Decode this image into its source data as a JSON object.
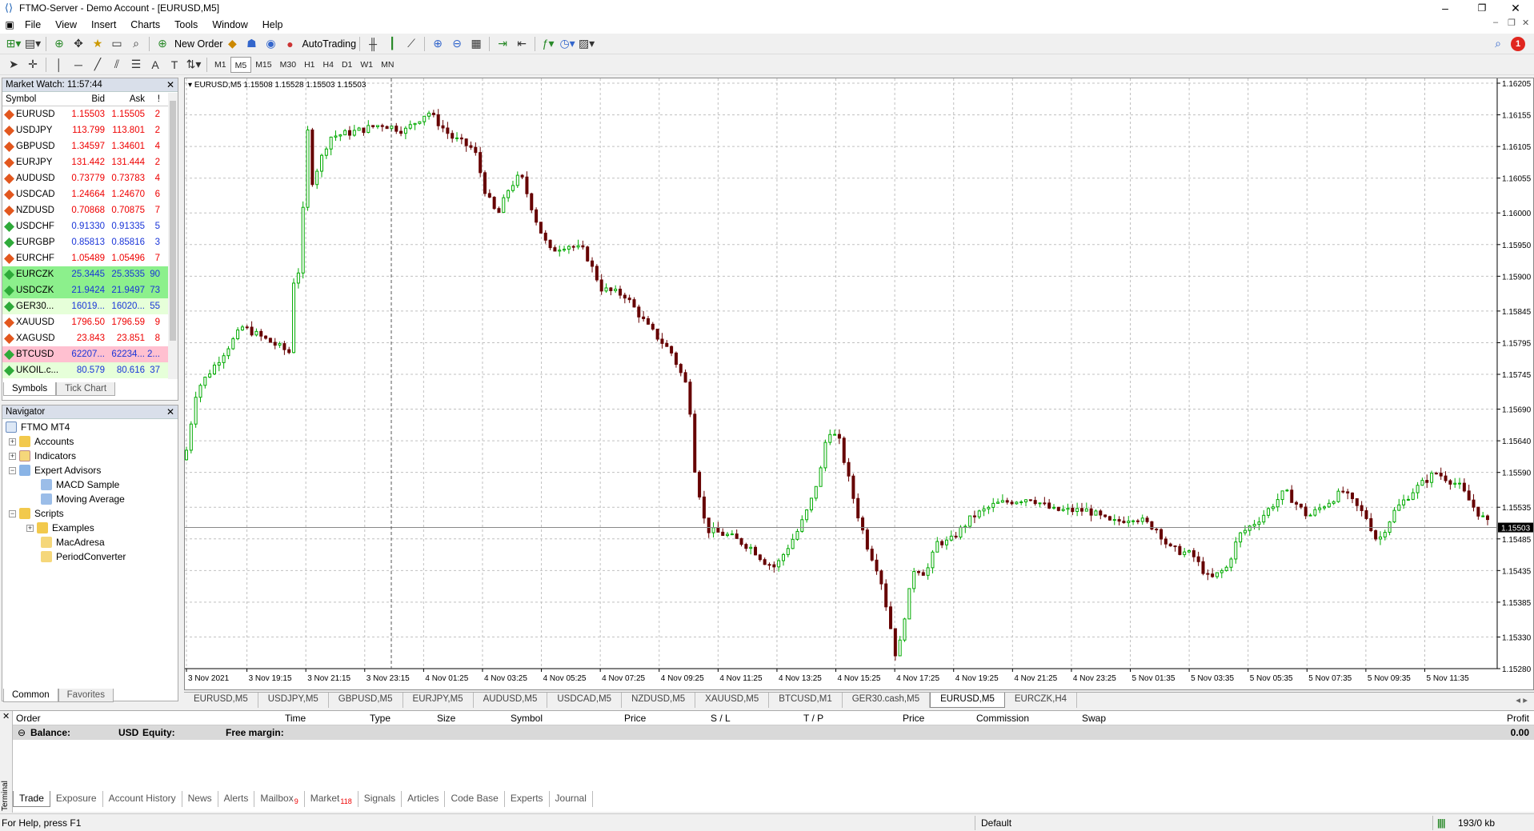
{
  "window": {
    "title": "FTMO-Server - Demo Account - [EURUSD,M5]"
  },
  "menu": [
    "File",
    "View",
    "Insert",
    "Charts",
    "Tools",
    "Window",
    "Help"
  ],
  "toolbar": {
    "new_order": "New Order",
    "autotrading": "AutoTrading",
    "alert_count": "1"
  },
  "timeframes": [
    "M1",
    "M5",
    "M15",
    "M30",
    "H1",
    "H4",
    "D1",
    "W1",
    "MN"
  ],
  "timeframe_active": "M5",
  "market_watch": {
    "title": "Market Watch: 11:57:44",
    "headers": {
      "symbol": "Symbol",
      "bid": "Bid",
      "ask": "Ask",
      "spread": "!"
    },
    "rows": [
      {
        "symbol": "EURUSD",
        "bid": "1.15503",
        "ask": "1.15505",
        "spread": "2",
        "dir": "up",
        "bg": "#ffffff",
        "icon": "#e2571e"
      },
      {
        "symbol": "USDJPY",
        "bid": "113.799",
        "ask": "113.801",
        "spread": "2",
        "dir": "up",
        "bg": "#ffffff",
        "icon": "#e2571e"
      },
      {
        "symbol": "GBPUSD",
        "bid": "1.34597",
        "ask": "1.34601",
        "spread": "4",
        "dir": "up",
        "bg": "#ffffff",
        "icon": "#e2571e"
      },
      {
        "symbol": "EURJPY",
        "bid": "131.442",
        "ask": "131.444",
        "spread": "2",
        "dir": "up",
        "bg": "#ffffff",
        "icon": "#e2571e"
      },
      {
        "symbol": "AUDUSD",
        "bid": "0.73779",
        "ask": "0.73783",
        "spread": "4",
        "dir": "up",
        "bg": "#ffffff",
        "icon": "#e2571e"
      },
      {
        "symbol": "USDCAD",
        "bid": "1.24664",
        "ask": "1.24670",
        "spread": "6",
        "dir": "up",
        "bg": "#ffffff",
        "icon": "#e2571e"
      },
      {
        "symbol": "NZDUSD",
        "bid": "0.70868",
        "ask": "0.70875",
        "spread": "7",
        "dir": "up",
        "bg": "#ffffff",
        "icon": "#e2571e"
      },
      {
        "symbol": "USDCHF",
        "bid": "0.91330",
        "ask": "0.91335",
        "spread": "5",
        "dir": "dn",
        "bg": "#ffffff",
        "icon": "#2faa3a"
      },
      {
        "symbol": "EURGBP",
        "bid": "0.85813",
        "ask": "0.85816",
        "spread": "3",
        "dir": "dn",
        "bg": "#ffffff",
        "icon": "#2faa3a"
      },
      {
        "symbol": "EURCHF",
        "bid": "1.05489",
        "ask": "1.05496",
        "spread": "7",
        "dir": "up",
        "bg": "#ffffff",
        "icon": "#e2571e"
      },
      {
        "symbol": "EURCZK",
        "bid": "25.3445",
        "ask": "25.3535",
        "spread": "90",
        "dir": "dn",
        "bg": "#8cf08c",
        "icon": "#2faa3a"
      },
      {
        "symbol": "USDCZK",
        "bid": "21.9424",
        "ask": "21.9497",
        "spread": "73",
        "dir": "dn",
        "bg": "#8cf08c",
        "icon": "#2faa3a"
      },
      {
        "symbol": "GER30...",
        "bid": "16019...",
        "ask": "16020...",
        "spread": "55",
        "dir": "dn",
        "bg": "#e6ffd9",
        "icon": "#2faa3a"
      },
      {
        "symbol": "XAUUSD",
        "bid": "1796.50",
        "ask": "1796.59",
        "spread": "9",
        "dir": "up",
        "bg": "#ffffff",
        "icon": "#e2571e"
      },
      {
        "symbol": "XAGUSD",
        "bid": "23.843",
        "ask": "23.851",
        "spread": "8",
        "dir": "up",
        "bg": "#ffffff",
        "icon": "#e2571e"
      },
      {
        "symbol": "BTCUSD",
        "bid": "62207...",
        "ask": "62234...",
        "spread": "2...",
        "dir": "dn",
        "bg": "#ffc0d0",
        "icon": "#2faa3a"
      },
      {
        "symbol": "UKOIL.c...",
        "bid": "80.579",
        "ask": "80.616",
        "spread": "37",
        "dir": "dn",
        "bg": "#e6ffd9",
        "icon": "#2faa3a"
      }
    ],
    "tabs": [
      "Symbols",
      "Tick Chart"
    ]
  },
  "navigator": {
    "title": "Navigator",
    "root": "FTMO MT4",
    "items": [
      "Accounts",
      "Indicators",
      "Expert Advisors",
      "MACD Sample",
      "Moving Average",
      "Scripts",
      "Examples",
      "MacAdresa",
      "PeriodConverter"
    ],
    "tabs": [
      "Common",
      "Favorites"
    ]
  },
  "chart": {
    "header": "EURUSD,M5  1.15508 1.15528 1.15503 1.15503",
    "price_tag": "1.15503",
    "price_levels": [
      "1.16205",
      "1.16155",
      "1.16105",
      "1.16055",
      "1.16000",
      "1.15950",
      "1.15900",
      "1.15845",
      "1.15795",
      "1.15745",
      "1.15690",
      "1.15640",
      "1.15590",
      "1.15535",
      "1.15485",
      "1.15435",
      "1.15385",
      "1.15330",
      "1.15280"
    ],
    "time_labels": [
      "3 Nov 2021",
      "3 Nov 19:15",
      "3 Nov 21:15",
      "3 Nov 23:15",
      "4 Nov 01:25",
      "4 Nov 03:25",
      "4 Nov 05:25",
      "4 Nov 07:25",
      "4 Nov 09:25",
      "4 Nov 11:25",
      "4 Nov 13:25",
      "4 Nov 15:25",
      "4 Nov 17:25",
      "4 Nov 19:25",
      "4 Nov 21:25",
      "4 Nov 23:25",
      "5 Nov 01:35",
      "5 Nov 03:35",
      "5 Nov 05:35",
      "5 Nov 07:35",
      "5 Nov 09:35",
      "5 Nov 11:35"
    ],
    "colors": {
      "bull": "#00aa00",
      "bear": "#660000",
      "grid": "#c0c0c0",
      "tag_bg": "#000000"
    }
  },
  "chart_tabs": [
    "EURUSD,M5",
    "USDJPY,M5",
    "GBPUSD,M5",
    "EURJPY,M5",
    "AUDUSD,M5",
    "USDCAD,M5",
    "NZDUSD,M5",
    "XAUUSD,M5",
    "BTCUSD,M1",
    "GER30.cash,M5",
    "EURUSD,M5",
    "EURCZK,H4"
  ],
  "chart_tab_active": 10,
  "terminal": {
    "side_label": "Terminal",
    "columns": [
      "Order",
      "Time",
      "Type",
      "Size",
      "Symbol",
      "Price",
      "S / L",
      "T / P",
      "Price",
      "Commission",
      "Swap",
      "Profit"
    ],
    "balance_label": "Balance:",
    "balance_currency": "USD",
    "equity_label": "Equity:",
    "free_margin_label": "Free margin:",
    "profit": "0.00",
    "tabs": [
      {
        "label": "Trade",
        "badge": ""
      },
      {
        "label": "Exposure",
        "badge": ""
      },
      {
        "label": "Account History",
        "badge": ""
      },
      {
        "label": "News",
        "badge": ""
      },
      {
        "label": "Alerts",
        "badge": ""
      },
      {
        "label": "Mailbox",
        "badge": "9"
      },
      {
        "label": "Market",
        "badge": "118"
      },
      {
        "label": "Signals",
        "badge": ""
      },
      {
        "label": "Articles",
        "badge": ""
      },
      {
        "label": "Code Base",
        "badge": ""
      },
      {
        "label": "Experts",
        "badge": ""
      },
      {
        "label": "Journal",
        "badge": ""
      }
    ]
  },
  "status": {
    "help": "For Help, press F1",
    "profile": "Default",
    "traffic": "193/0 kb"
  }
}
